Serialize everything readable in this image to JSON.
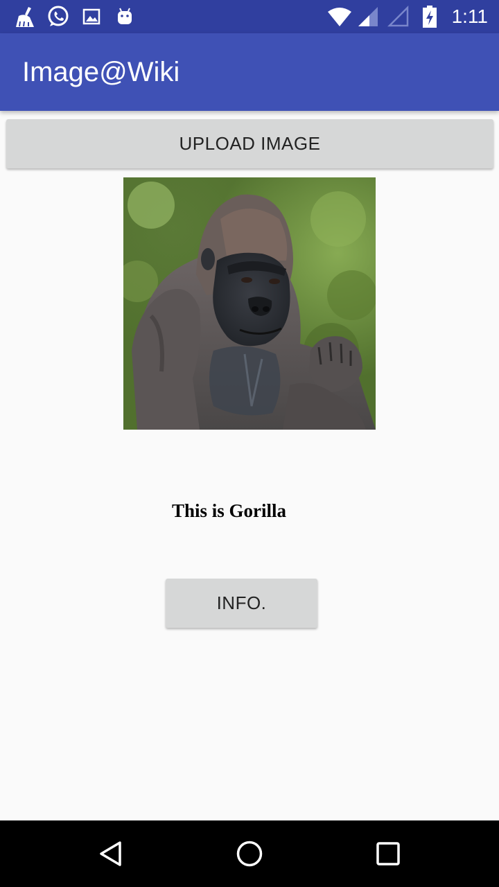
{
  "status_bar": {
    "time": "1:11",
    "icons": [
      "cleaner-icon",
      "whatsapp-icon",
      "gallery-icon",
      "android-icon",
      "wifi-icon",
      "signal-icon",
      "signal-empty-icon",
      "battery-charging-icon"
    ]
  },
  "app_bar": {
    "title": "Image@Wiki"
  },
  "main": {
    "upload_label": "UPLOAD IMAGE",
    "result_text": "This is Gorilla",
    "info_label": "INFO."
  },
  "nav_bar": {
    "icons": [
      "back-icon",
      "home-icon",
      "recents-icon"
    ]
  },
  "colors": {
    "status_bar": "#303f9f",
    "app_bar": "#3f51b5",
    "button": "#d6d7d7",
    "background": "#fafafa"
  }
}
